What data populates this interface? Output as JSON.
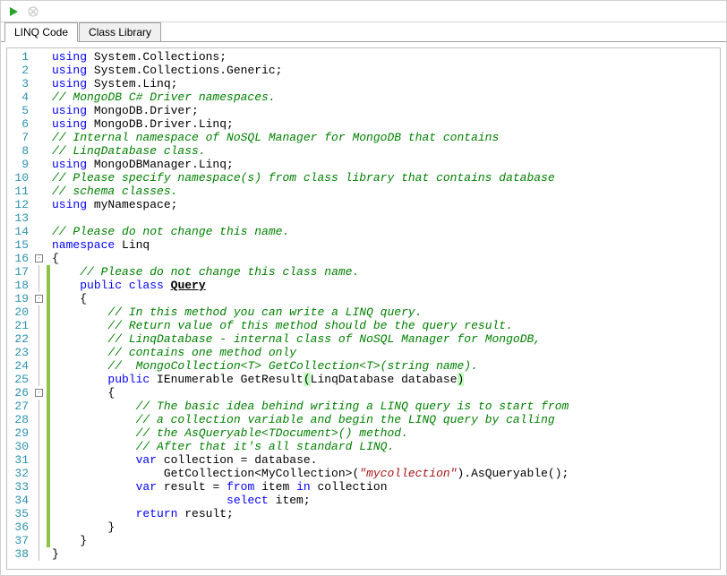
{
  "toolbar": {
    "play_label": "Run",
    "stop_label": "Stop"
  },
  "tabs": {
    "tab1": "LINQ Code",
    "tab2": "Class Library"
  },
  "code_lines": [
    {
      "n": 1,
      "segs": [
        {
          "t": "using ",
          "c": "c-kw"
        },
        {
          "t": "System.Collections;",
          "c": "c-normal"
        }
      ]
    },
    {
      "n": 2,
      "segs": [
        {
          "t": "using ",
          "c": "c-kw"
        },
        {
          "t": "System.Collections.Generic;",
          "c": "c-normal"
        }
      ]
    },
    {
      "n": 3,
      "segs": [
        {
          "t": "using ",
          "c": "c-kw"
        },
        {
          "t": "System.Linq;",
          "c": "c-normal"
        }
      ]
    },
    {
      "n": 4,
      "segs": [
        {
          "t": "// MongoDB C# Driver namespaces.",
          "c": "c-comment"
        }
      ]
    },
    {
      "n": 5,
      "segs": [
        {
          "t": "using ",
          "c": "c-kw"
        },
        {
          "t": "MongoDB.Driver;",
          "c": "c-normal"
        }
      ]
    },
    {
      "n": 6,
      "segs": [
        {
          "t": "using ",
          "c": "c-kw"
        },
        {
          "t": "MongoDB.Driver.Linq;",
          "c": "c-normal"
        }
      ]
    },
    {
      "n": 7,
      "segs": [
        {
          "t": "// Internal namespace of NoSQL Manager for MongoDB that contains",
          "c": "c-comment"
        }
      ]
    },
    {
      "n": 8,
      "segs": [
        {
          "t": "// LinqDatabase class.",
          "c": "c-comment"
        }
      ]
    },
    {
      "n": 9,
      "segs": [
        {
          "t": "using ",
          "c": "c-kw"
        },
        {
          "t": "MongoDBManager.Linq;",
          "c": "c-normal"
        }
      ]
    },
    {
      "n": 10,
      "segs": [
        {
          "t": "// Please specify namespace(s) from class library that contains database",
          "c": "c-comment"
        }
      ]
    },
    {
      "n": 11,
      "segs": [
        {
          "t": "// schema classes.",
          "c": "c-comment"
        }
      ]
    },
    {
      "n": 12,
      "segs": [
        {
          "t": "using ",
          "c": "c-kw"
        },
        {
          "t": "myNamespace;",
          "c": "c-normal"
        }
      ]
    },
    {
      "n": 13,
      "segs": [
        {
          "t": "",
          "c": "c-normal"
        }
      ]
    },
    {
      "n": 14,
      "segs": [
        {
          "t": "// Please do not change this name.",
          "c": "c-comment"
        }
      ]
    },
    {
      "n": 15,
      "segs": [
        {
          "t": "namespace ",
          "c": "c-kw"
        },
        {
          "t": "Linq",
          "c": "c-normal"
        }
      ]
    },
    {
      "n": 16,
      "segs": [
        {
          "t": "{",
          "c": "c-normal"
        }
      ]
    },
    {
      "n": 17,
      "segs": [
        {
          "t": "    ",
          "c": "c-normal"
        },
        {
          "t": "// Please do not change this class name.",
          "c": "c-comment"
        }
      ]
    },
    {
      "n": 18,
      "segs": [
        {
          "t": "    ",
          "c": "c-normal"
        },
        {
          "t": "public class ",
          "c": "c-kw"
        },
        {
          "t": "Query",
          "c": "c-underline"
        }
      ]
    },
    {
      "n": 19,
      "segs": [
        {
          "t": "    { ",
          "c": "c-normal"
        }
      ]
    },
    {
      "n": 20,
      "segs": [
        {
          "t": "        ",
          "c": "c-normal"
        },
        {
          "t": "// In this method you can write a LINQ query.",
          "c": "c-comment"
        }
      ]
    },
    {
      "n": 21,
      "segs": [
        {
          "t": "        ",
          "c": "c-normal"
        },
        {
          "t": "// Return value of this method should be the query result.",
          "c": "c-comment"
        }
      ]
    },
    {
      "n": 22,
      "segs": [
        {
          "t": "        ",
          "c": "c-normal"
        },
        {
          "t": "// LinqDatabase - internal class of NoSQL Manager for MongoDB,",
          "c": "c-comment"
        }
      ]
    },
    {
      "n": 23,
      "segs": [
        {
          "t": "        ",
          "c": "c-normal"
        },
        {
          "t": "// contains one method only",
          "c": "c-comment"
        }
      ]
    },
    {
      "n": 24,
      "segs": [
        {
          "t": "        ",
          "c": "c-normal"
        },
        {
          "t": "//  MongoCollection<T> GetCollection<T>(string name).",
          "c": "c-comment"
        }
      ]
    },
    {
      "n": 25,
      "segs": [
        {
          "t": "        ",
          "c": "c-normal"
        },
        {
          "t": "public ",
          "c": "c-kw"
        },
        {
          "t": "IEnumerable GetResult",
          "c": "c-normal"
        },
        {
          "t": "(",
          "c": "c-paren-hl"
        },
        {
          "t": "LinqDatabase database",
          "c": "c-normal"
        },
        {
          "t": ")",
          "c": "c-paren-hl"
        }
      ]
    },
    {
      "n": 26,
      "segs": [
        {
          "t": "        {",
          "c": "c-normal"
        }
      ]
    },
    {
      "n": 27,
      "segs": [
        {
          "t": "            ",
          "c": "c-normal"
        },
        {
          "t": "// The basic idea behind writing a LINQ query is to start from",
          "c": "c-comment"
        }
      ]
    },
    {
      "n": 28,
      "segs": [
        {
          "t": "            ",
          "c": "c-normal"
        },
        {
          "t": "// a collection variable and begin the LINQ query by calling",
          "c": "c-comment"
        }
      ]
    },
    {
      "n": 29,
      "segs": [
        {
          "t": "            ",
          "c": "c-normal"
        },
        {
          "t": "// the AsQueryable<TDocument>() method.",
          "c": "c-comment"
        }
      ]
    },
    {
      "n": 30,
      "segs": [
        {
          "t": "            ",
          "c": "c-normal"
        },
        {
          "t": "// After that it's all standard LINQ.",
          "c": "c-comment"
        }
      ]
    },
    {
      "n": 31,
      "segs": [
        {
          "t": "            ",
          "c": "c-normal"
        },
        {
          "t": "var ",
          "c": "c-kw"
        },
        {
          "t": "collection = database.",
          "c": "c-normal"
        }
      ]
    },
    {
      "n": 32,
      "segs": [
        {
          "t": "                GetCollection<MyCollection>(",
          "c": "c-normal"
        },
        {
          "t": "\"mycollection\"",
          "c": "c-str"
        },
        {
          "t": ").AsQueryable();",
          "c": "c-normal"
        }
      ]
    },
    {
      "n": 33,
      "segs": [
        {
          "t": "            ",
          "c": "c-normal"
        },
        {
          "t": "var ",
          "c": "c-kw"
        },
        {
          "t": "result = ",
          "c": "c-normal"
        },
        {
          "t": "from ",
          "c": "c-kw"
        },
        {
          "t": "item ",
          "c": "c-normal"
        },
        {
          "t": "in ",
          "c": "c-kw"
        },
        {
          "t": "collection",
          "c": "c-normal"
        }
      ]
    },
    {
      "n": 34,
      "segs": [
        {
          "t": "                         ",
          "c": "c-normal"
        },
        {
          "t": "select ",
          "c": "c-kw"
        },
        {
          "t": "item;",
          "c": "c-normal"
        }
      ]
    },
    {
      "n": 35,
      "segs": [
        {
          "t": "            ",
          "c": "c-normal"
        },
        {
          "t": "return ",
          "c": "c-kw"
        },
        {
          "t": "result;",
          "c": "c-normal"
        }
      ]
    },
    {
      "n": 36,
      "segs": [
        {
          "t": "        }",
          "c": "c-normal"
        }
      ]
    },
    {
      "n": 37,
      "segs": [
        {
          "t": "    }",
          "c": "c-normal"
        }
      ]
    },
    {
      "n": 38,
      "segs": [
        {
          "t": "}",
          "c": "c-normal"
        }
      ]
    }
  ],
  "fold_points": [
    16,
    19,
    26
  ],
  "change_lines_start": 17,
  "change_lines_end": 37
}
